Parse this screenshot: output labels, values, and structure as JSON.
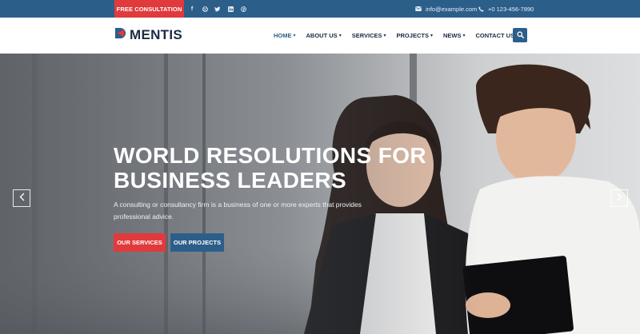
{
  "topbar": {
    "cta_label": "FREE CONSULTATION",
    "social_icons": [
      "facebook-icon",
      "dribbble-icon",
      "twitter-icon",
      "linkedin-icon",
      "pinterest-icon"
    ],
    "email": "info@example.com",
    "phone": "+0 123-456-7890"
  },
  "header": {
    "logo_text": "MENTIS",
    "nav": [
      {
        "label": "HOME",
        "has_dropdown": true,
        "active": true
      },
      {
        "label": "ABOUT US",
        "has_dropdown": true,
        "active": false
      },
      {
        "label": "SERVICES",
        "has_dropdown": true,
        "active": false
      },
      {
        "label": "PROJECTS",
        "has_dropdown": true,
        "active": false
      },
      {
        "label": "NEWS",
        "has_dropdown": true,
        "active": false
      },
      {
        "label": "CONTACT US",
        "has_dropdown": false,
        "active": false
      }
    ]
  },
  "hero": {
    "title_line1": "WORLD RESOLUTIONS FOR",
    "title_line2": "BUSINESS LEADERS",
    "subtitle": "A consulting or consultancy firm is a business of one or more experts that provides professional advice.",
    "primary_button": "OUR SERVICES",
    "secondary_button": "OUR PROJECTS"
  },
  "colors": {
    "brand_blue": "#2c5e8a",
    "accent_red": "#e03a3c",
    "dark_text": "#1b2a44"
  }
}
